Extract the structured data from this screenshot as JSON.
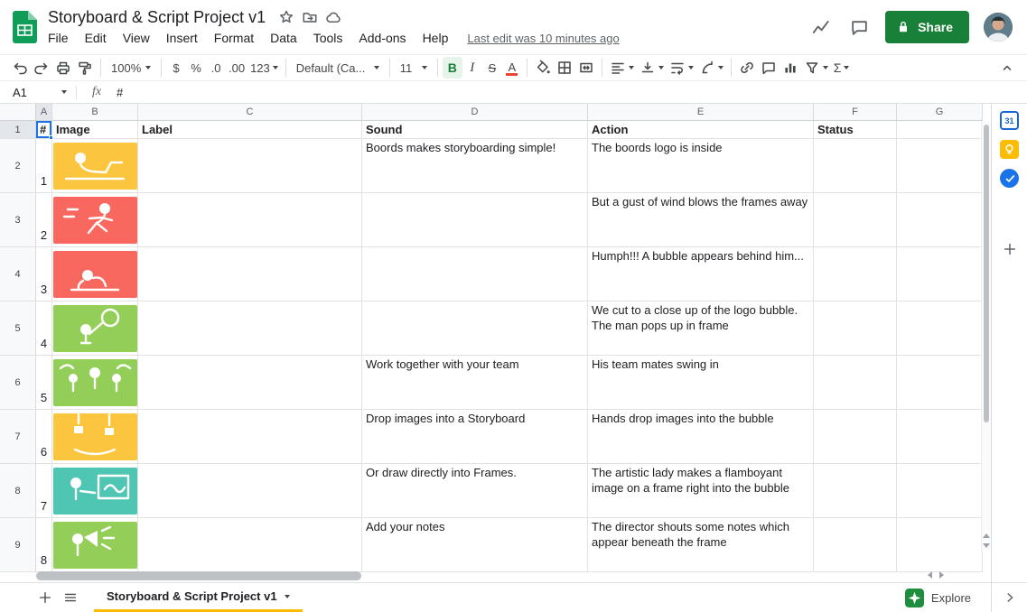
{
  "app_bar": {
    "doc_title": "Storyboard & Script Project v1",
    "menus": [
      "File",
      "Edit",
      "View",
      "Insert",
      "Format",
      "Data",
      "Tools",
      "Add-ons",
      "Help"
    ],
    "last_edit": "Last edit was 10 minutes ago",
    "share_label": "Share"
  },
  "toolbar": {
    "zoom": "100%",
    "currency": "$",
    "percent": "%",
    "decrease_decimal": ".0",
    "increase_decimal": ".00",
    "more_formats": "123",
    "font_name": "Default (Ca...",
    "font_size": "11",
    "bold": "B",
    "italic": "I",
    "strikethrough": "S",
    "text_color": "A",
    "functions": "Σ"
  },
  "formula_bar": {
    "cell_ref": "A1",
    "fx_label": "fx",
    "value": "#"
  },
  "grid": {
    "column_letters": [
      "A",
      "B",
      "C",
      "D",
      "E",
      "F",
      "G"
    ],
    "row_numbers": [
      "1",
      "2",
      "3",
      "4",
      "5",
      "6",
      "7",
      "8",
      "9"
    ],
    "header_row": {
      "a": "#",
      "b": "Image",
      "c": "Label",
      "d": "Sound",
      "e": "Action",
      "f": "Status"
    },
    "rows": [
      {
        "frame": "1",
        "label": "",
        "sound": "Boords makes storyboarding simple!",
        "action": "The boords logo is inside",
        "status": "",
        "image_color": "#fbc63d"
      },
      {
        "frame": "2",
        "label": "",
        "sound": "",
        "action": "But a gust of wind blows the frames away",
        "status": "",
        "image_color": "#f8685e"
      },
      {
        "frame": "3",
        "label": "",
        "sound": "",
        "action": "Humph!!! A bubble appears behind him...",
        "status": "",
        "image_color": "#f8685e"
      },
      {
        "frame": "4",
        "label": "",
        "sound": "",
        "action": "We cut to a close up of the logo bubble. The man pops up in frame",
        "status": "",
        "image_color": "#93ce58"
      },
      {
        "frame": "5",
        "label": "",
        "sound": "Work together with your team",
        "action": "His team mates swing in",
        "status": "",
        "image_color": "#93ce58"
      },
      {
        "frame": "6",
        "label": "",
        "sound": "Drop images into a Storyboard",
        "action": "Hands drop images into the bubble",
        "status": "",
        "image_color": "#fbc63d"
      },
      {
        "frame": "7",
        "label": "",
        "sound": "Or draw directly into Frames.",
        "action": "The artistic lady makes a flamboyant image on a frame right into the bubble",
        "status": "",
        "image_color": "#4fc5b3"
      },
      {
        "frame": "8",
        "label": "",
        "sound": "Add your notes",
        "action": "The director shouts some notes which appear beneath the frame",
        "status": "",
        "image_color": "#93ce58"
      }
    ]
  },
  "sheet_bar": {
    "tab_label": "Storyboard & Script Project v1",
    "explore_label": "Explore"
  },
  "side_panel": {
    "calendar_day": "31"
  },
  "colors": {
    "logo_green": "#0f9d58",
    "logo_fold": "#87ceac",
    "share_green": "#188038",
    "selection_blue": "#1a73e8",
    "bold_active_green": "#188038",
    "text_color_indicator": "#ea4335",
    "tab_underline": "#fbbc04",
    "explore_green": "#1e8e3e",
    "calendar_blue": "#1967d2",
    "keep_yellow": "#fbbc04",
    "tasks_blue": "#1a73e8"
  }
}
